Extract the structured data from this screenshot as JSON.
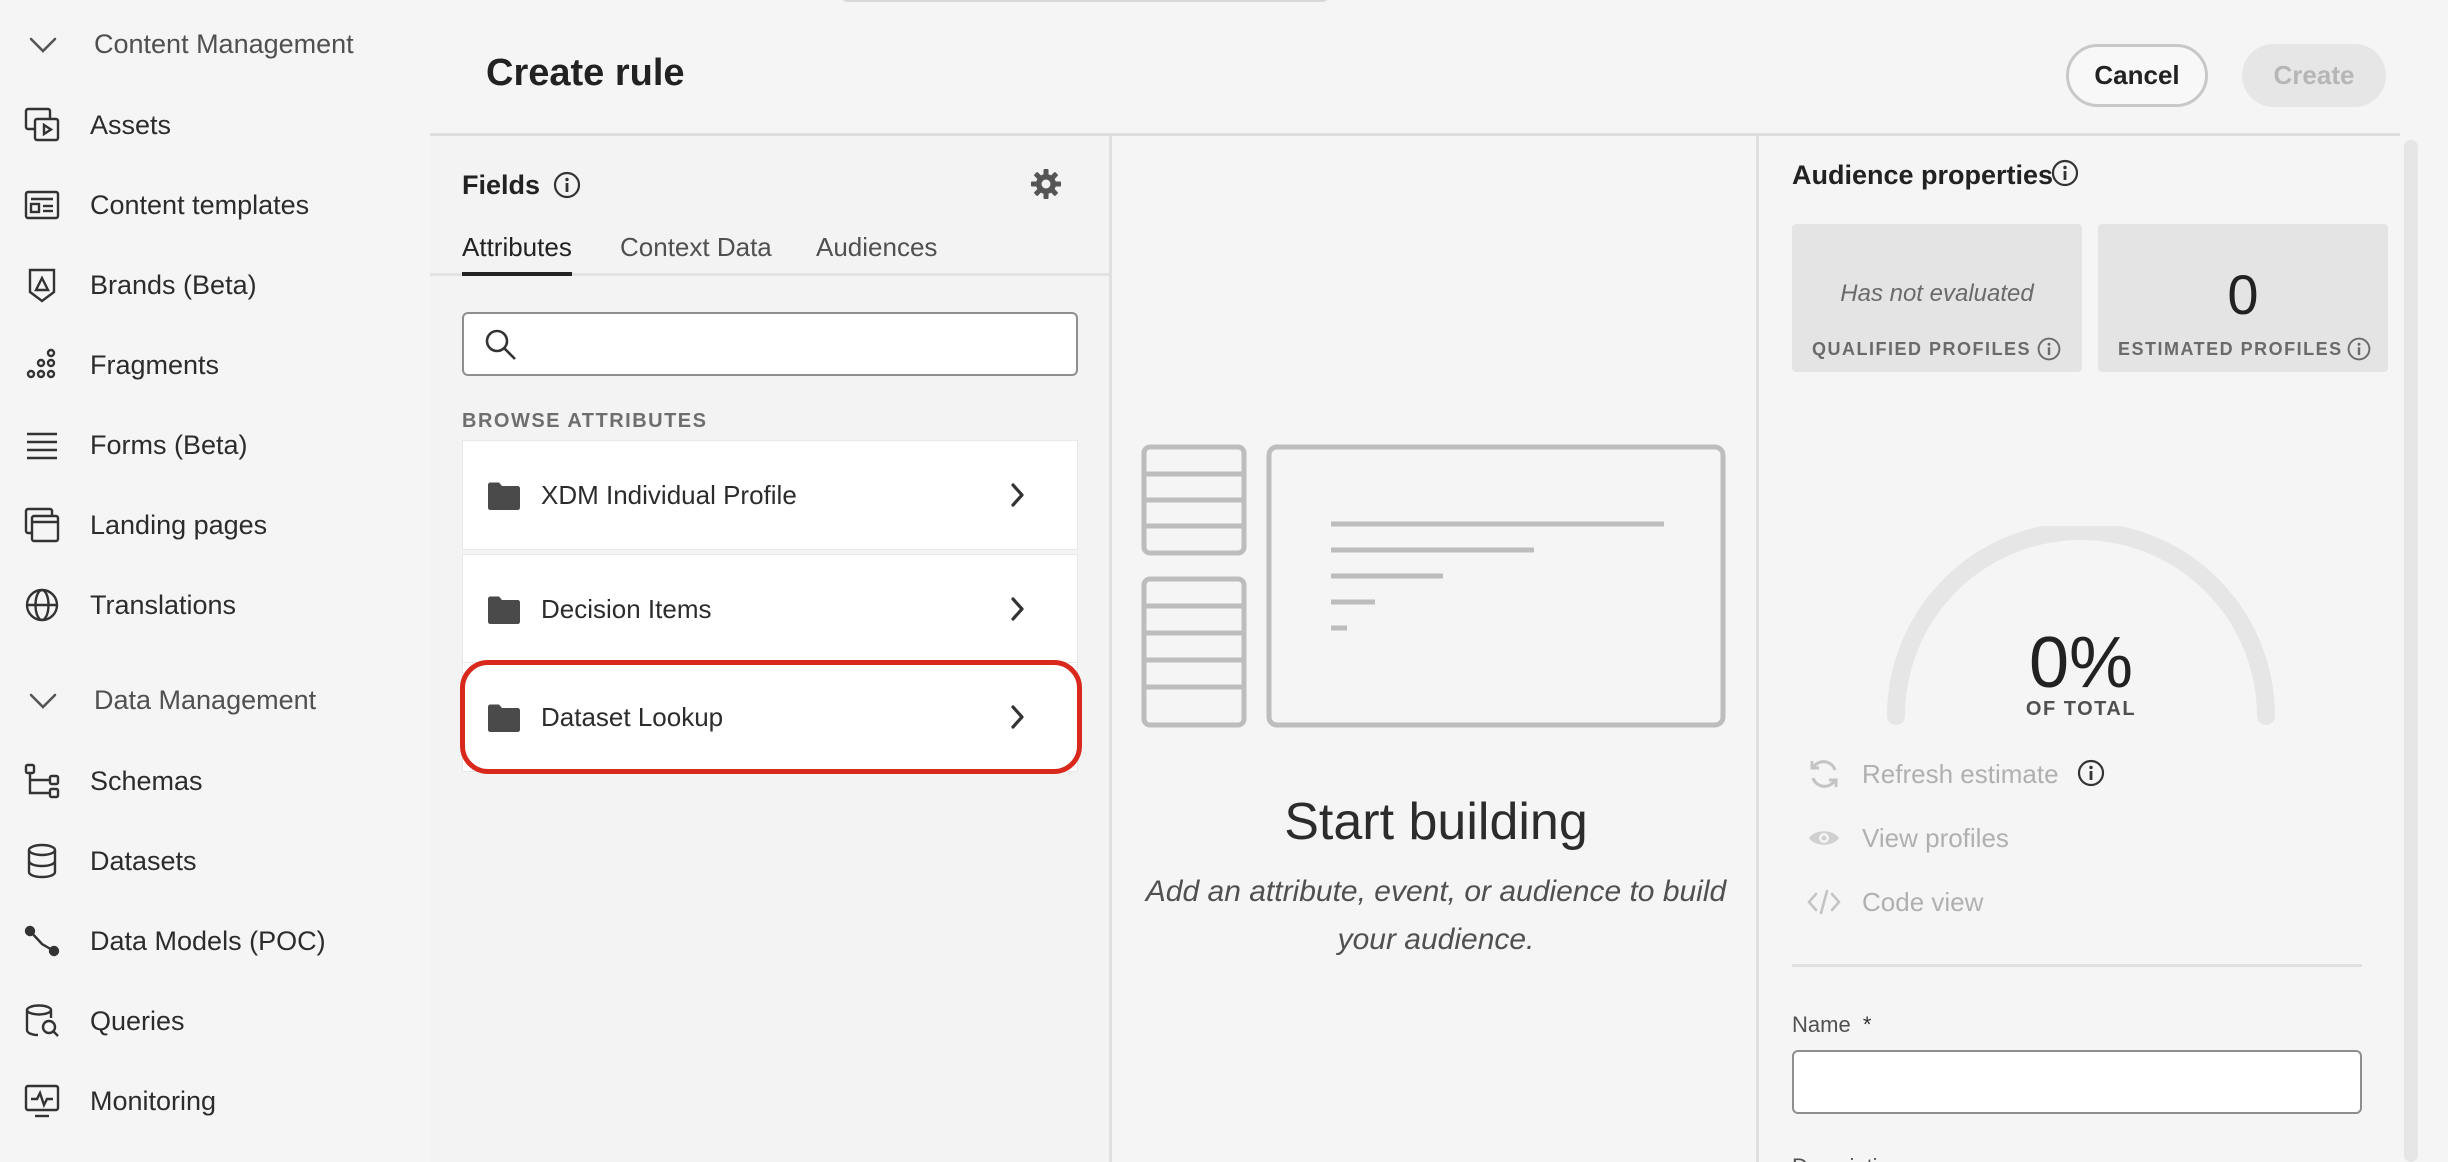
{
  "nav": {
    "sections": [
      {
        "label": "Content Management"
      },
      {
        "label": "Data Management"
      }
    ],
    "content_items": [
      {
        "label": "Assets",
        "icon": "assets-icon"
      },
      {
        "label": "Content templates",
        "icon": "content-templates-icon"
      },
      {
        "label": "Brands (Beta)",
        "icon": "brands-icon"
      },
      {
        "label": "Fragments",
        "icon": "fragments-icon"
      },
      {
        "label": "Forms (Beta)",
        "icon": "forms-icon"
      },
      {
        "label": "Landing pages",
        "icon": "landing-pages-icon"
      },
      {
        "label": "Translations",
        "icon": "globe-icon"
      }
    ],
    "data_items": [
      {
        "label": "Schemas",
        "icon": "schemas-icon"
      },
      {
        "label": "Datasets",
        "icon": "database-icon"
      },
      {
        "label": "Data Models (POC)",
        "icon": "data-models-icon"
      },
      {
        "label": "Queries",
        "icon": "queries-icon"
      },
      {
        "label": "Monitoring",
        "icon": "monitoring-icon"
      }
    ]
  },
  "header": {
    "title": "Create rule",
    "cancel_label": "Cancel",
    "create_label": "Create"
  },
  "fields": {
    "title": "Fields",
    "tabs": [
      {
        "label": "Attributes",
        "active": true
      },
      {
        "label": "Context Data",
        "active": false
      },
      {
        "label": "Audiences",
        "active": false
      }
    ],
    "search": {
      "value": "",
      "placeholder": ""
    },
    "browse_label": "BROWSE ATTRIBUTES",
    "folders": [
      {
        "label": "XDM Individual Profile"
      },
      {
        "label": "Decision Items"
      },
      {
        "label": "Dataset Lookup",
        "highlighted": true
      }
    ]
  },
  "canvas": {
    "title": "Start building",
    "subtitle": "Add an attribute, event, or audience to build your audience."
  },
  "audience": {
    "title": "Audience properties",
    "qualified": {
      "value": "Has not evaluated",
      "caption": "QUALIFIED PROFILES"
    },
    "estimated": {
      "value": "0",
      "caption": "ESTIMATED PROFILES"
    },
    "gauge": {
      "percent": "0%",
      "caption": "OF TOTAL",
      "fraction": 0
    },
    "actions": [
      {
        "label": "Refresh estimate",
        "icon": "refresh-icon"
      },
      {
        "label": "View profiles",
        "icon": "eye-icon"
      },
      {
        "label": "Code view",
        "icon": "code-icon"
      }
    ],
    "name_label": "Name",
    "required_mark": "*",
    "name_value": "",
    "description_label": "Description"
  },
  "colors": {
    "highlight": "#d9291c",
    "disabled_text": "#b0b0b0",
    "card_bg": "#e4e4e4"
  }
}
